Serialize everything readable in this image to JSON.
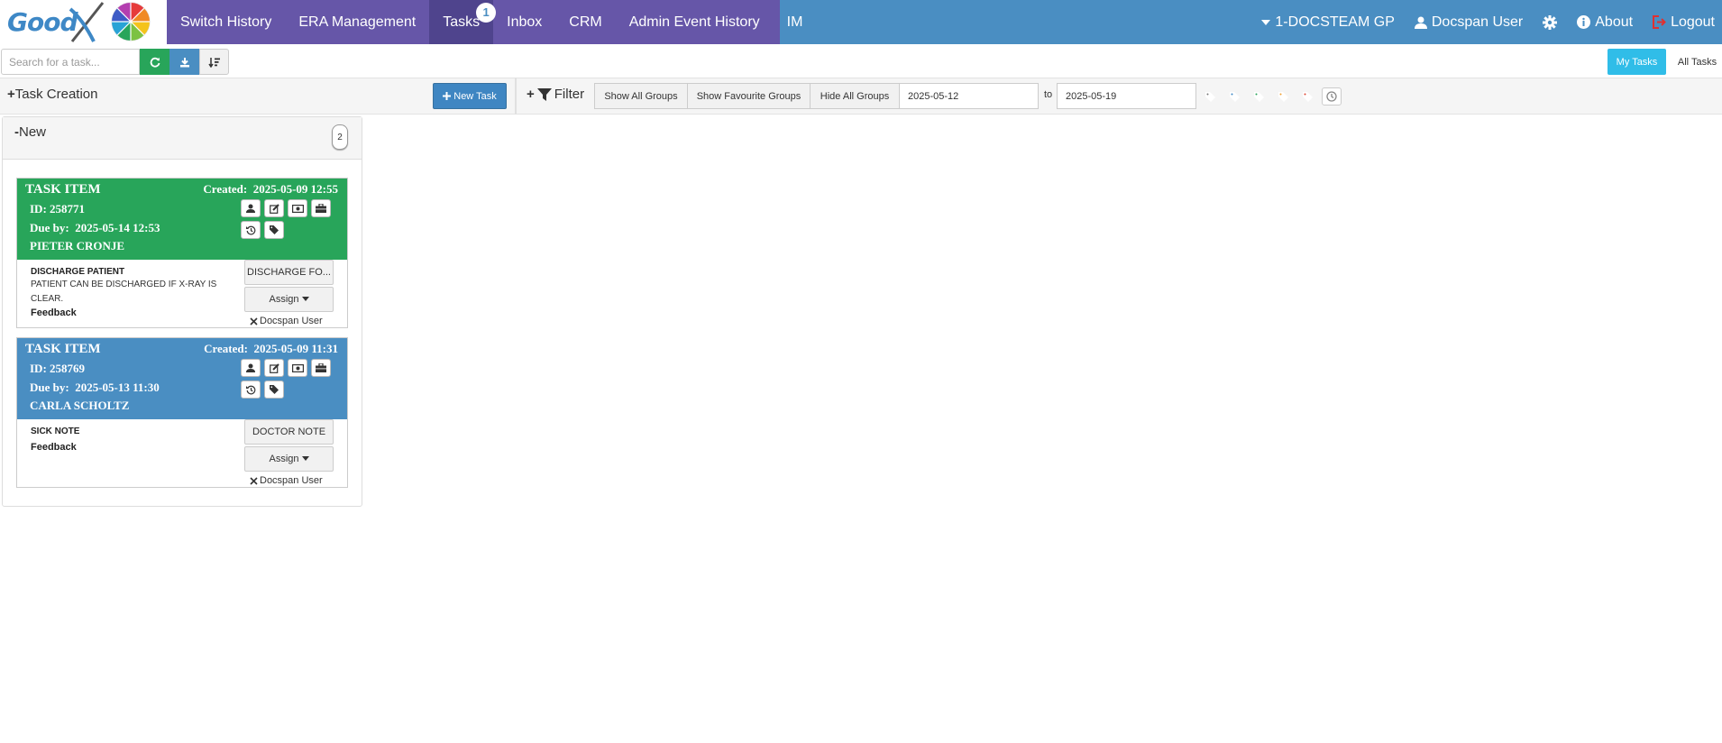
{
  "logo": {
    "text": "Good",
    "x_letter": "X"
  },
  "nav": {
    "left": [
      {
        "label": "Switch History"
      },
      {
        "label": "ERA Management"
      },
      {
        "label": "Tasks",
        "badge": "1"
      },
      {
        "label": "Inbox"
      },
      {
        "label": "CRM"
      },
      {
        "label": "Admin Event History"
      },
      {
        "label": "IM"
      }
    ],
    "practice": "1-DOCSTEAM GP",
    "user": "Docspan User",
    "about": "About",
    "logout": "Logout"
  },
  "toolbar": {
    "search_placeholder": "Search for a task...",
    "my_tasks": "My Tasks",
    "all_tasks": "All Tasks"
  },
  "task_creation": {
    "title": "Task Creation",
    "new_task_label": "New Task"
  },
  "filter": {
    "title": "Filter",
    "show_all_groups": "Show All Groups",
    "show_favourite_groups": "Show Favourite Groups",
    "hide_all_groups": "Hide All Groups",
    "date_from": "2025-05-12",
    "to_label": "to",
    "date_to": "2025-05-19",
    "tag_colors": [
      "#777777",
      "#3e88c6",
      "#28a55a",
      "#f0a030",
      "#dd4433"
    ]
  },
  "group": {
    "title": "New",
    "count": "2"
  },
  "tasks": [
    {
      "header_label": "TASK ITEM",
      "created_label": "Created:",
      "created": "2025-05-09 12:55",
      "id_label": "ID:",
      "id": "258771",
      "due_label": "Due by:",
      "due": "2025-05-14 12:53",
      "patient": "PIETER CRONJE",
      "type": "DISCHARGE PATIENT",
      "description": "PATIENT CAN BE DISCHARGED IF X-RAY IS CLEAR.",
      "feedback": "Feedback",
      "category_button": "DISCHARGE FO...",
      "assign_label": "Assign",
      "assignee": "Docspan User",
      "color": "#28a55a"
    },
    {
      "header_label": "TASK ITEM",
      "created_label": "Created:",
      "created": "2025-05-09 11:31",
      "id_label": "ID:",
      "id": "258769",
      "due_label": "Due by:",
      "due": "2025-05-13 11:30",
      "patient": "CARLA SCHOLTZ",
      "type": "SICK NOTE",
      "description": "",
      "feedback": "Feedback",
      "category_button": "DOCTOR NOTE",
      "assign_label": "Assign",
      "assignee": "Docspan User",
      "color": "#4a8ec2"
    }
  ]
}
